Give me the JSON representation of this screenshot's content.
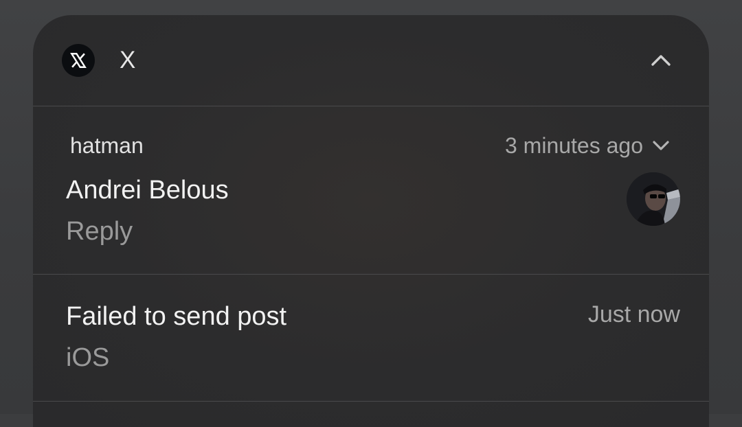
{
  "group": {
    "app_icon": "x-logo-icon",
    "app_name": "X",
    "collapse_icon": "chevron-up-icon"
  },
  "notifications": [
    {
      "app_label": "hatman",
      "time": "3 minutes ago",
      "expand_icon": "chevron-down-icon",
      "title": "Andrei Belous",
      "body": "Reply",
      "avatar": "user-avatar-photo"
    },
    {
      "title": "Failed to send post",
      "body": "iOS",
      "time": "Just now"
    }
  ],
  "colors": {
    "card_background": "#2c2c2d",
    "primary_text": "#f2f2f2",
    "secondary_text": "#9a9a9a",
    "divider": "#4a4a4c"
  }
}
